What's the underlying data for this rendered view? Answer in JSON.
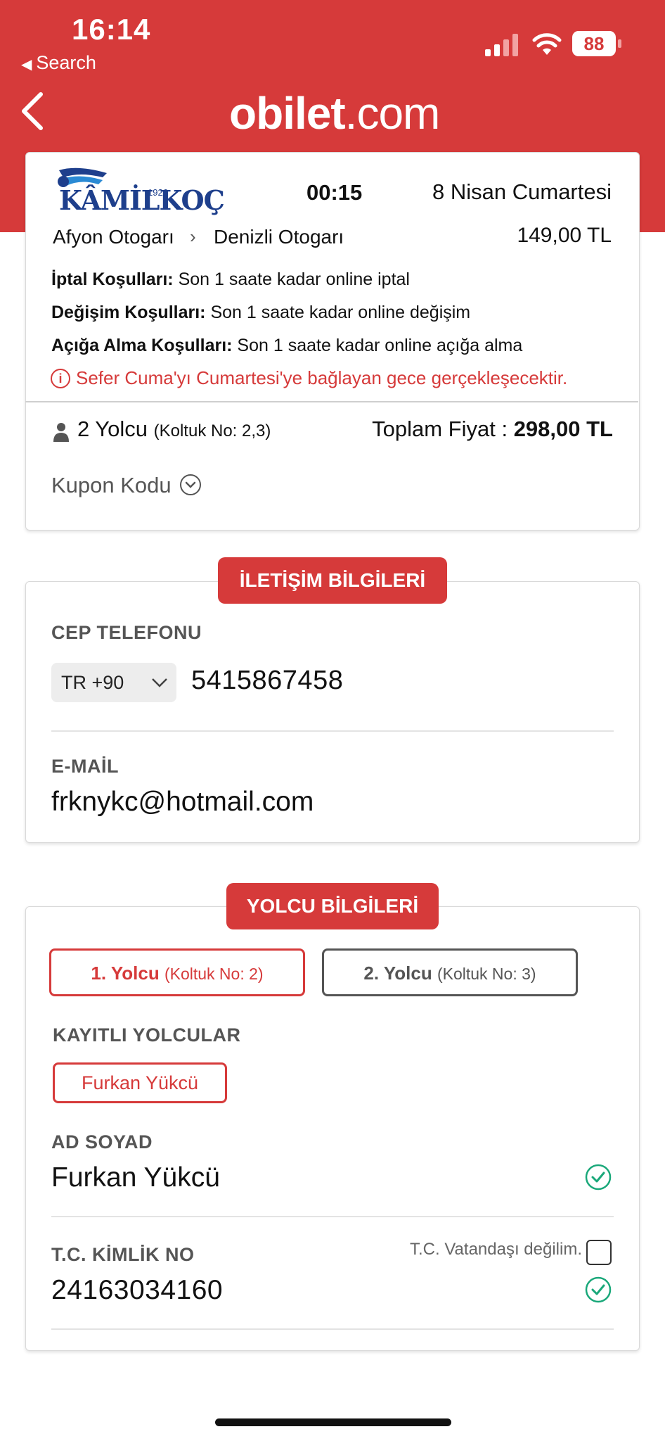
{
  "status_bar": {
    "time": "16:14",
    "back_label": "Search",
    "battery": "88"
  },
  "nav": {
    "logo_bold": "obilet",
    "logo_light": ".com"
  },
  "trip": {
    "company_name": "KÂMİLKOÇ",
    "company_year": "1926",
    "departure_time": "00:15",
    "date": "8 Nisan Cumartesi",
    "from": "Afyon Otogarı",
    "to": "Denizli Otogarı",
    "unit_price": "149,00 TL",
    "conditions": [
      {
        "label": "İptal Koşulları:",
        "value": " Son 1 saate kadar online iptal"
      },
      {
        "label": "Değişim Koşulları:",
        "value": " Son 1 saate kadar online değişim"
      },
      {
        "label": "Açığa Alma Koşulları:",
        "value": " Son 1 saate kadar online açığa alma"
      }
    ],
    "warning": "Sefer Cuma'yı Cumartesi'ye bağlayan gece gerçekleşecektir.",
    "passengers": "2 Yolcu",
    "seats": "(Koltuk No: 2,3)",
    "total_label": "Toplam Fiyat : ",
    "total_value": "298,00 TL",
    "coupon_label": "Kupon Kodu"
  },
  "contact": {
    "section_title": "İLETİŞİM BİLGİLERİ",
    "phone_label": "CEP TELEFONU",
    "country_code": "TR +90",
    "phone_value": "5415867458",
    "email_label": "E-MAİL",
    "email_value": "frknykc@hotmail.com"
  },
  "passenger_info": {
    "section_title": "YOLCU BİLGİLERİ",
    "tabs": [
      {
        "label": "1. Yolcu",
        "seat": "(Koltuk No: 2)"
      },
      {
        "label": "2. Yolcu",
        "seat": "(Koltuk No: 3)"
      }
    ],
    "saved_label": "KAYITLI YOLCULAR",
    "saved_passenger": "Furkan Yükcü",
    "name_label": "AD SOYAD",
    "name_value": "Furkan Yükcü",
    "tc_label": "T.C. KİMLİK NO",
    "tc_value": "24163034160",
    "not_citizen_label": "T.C. Vatandaşı değilim."
  },
  "colors": {
    "brand_red": "#d63a3a",
    "valid_green": "#1aa87a",
    "kamilkoc_blue": "#1e3f8c"
  }
}
